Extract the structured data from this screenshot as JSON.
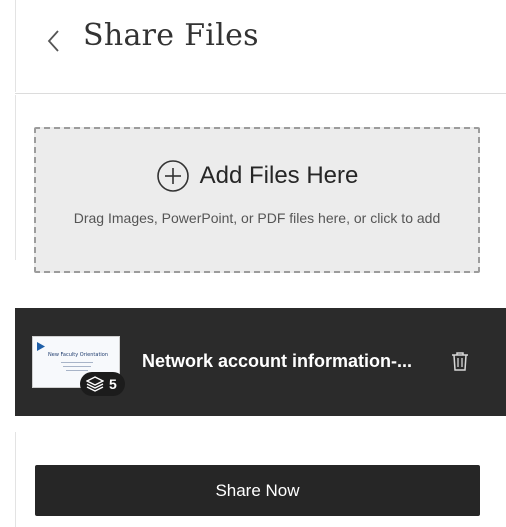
{
  "header": {
    "title": "Share Files",
    "back_icon": "chevron-left-icon"
  },
  "dropzone": {
    "title": "Add Files Here",
    "description": "Drag Images, PowerPoint, or PDF files here, or click to add",
    "icon": "plus-circle-icon"
  },
  "file": {
    "name": "Network account information-...",
    "thumbnail_title": "New Faculty Orientation",
    "slide_count": "5",
    "layers_icon": "layers-icon",
    "delete_icon": "trash-icon"
  },
  "actions": {
    "share_label": "Share Now"
  },
  "colors": {
    "file_row_bg": "#2b2b2b",
    "button_bg": "#262626",
    "dropzone_bg": "#ececec",
    "dropzone_border": "#9c9c9c"
  }
}
